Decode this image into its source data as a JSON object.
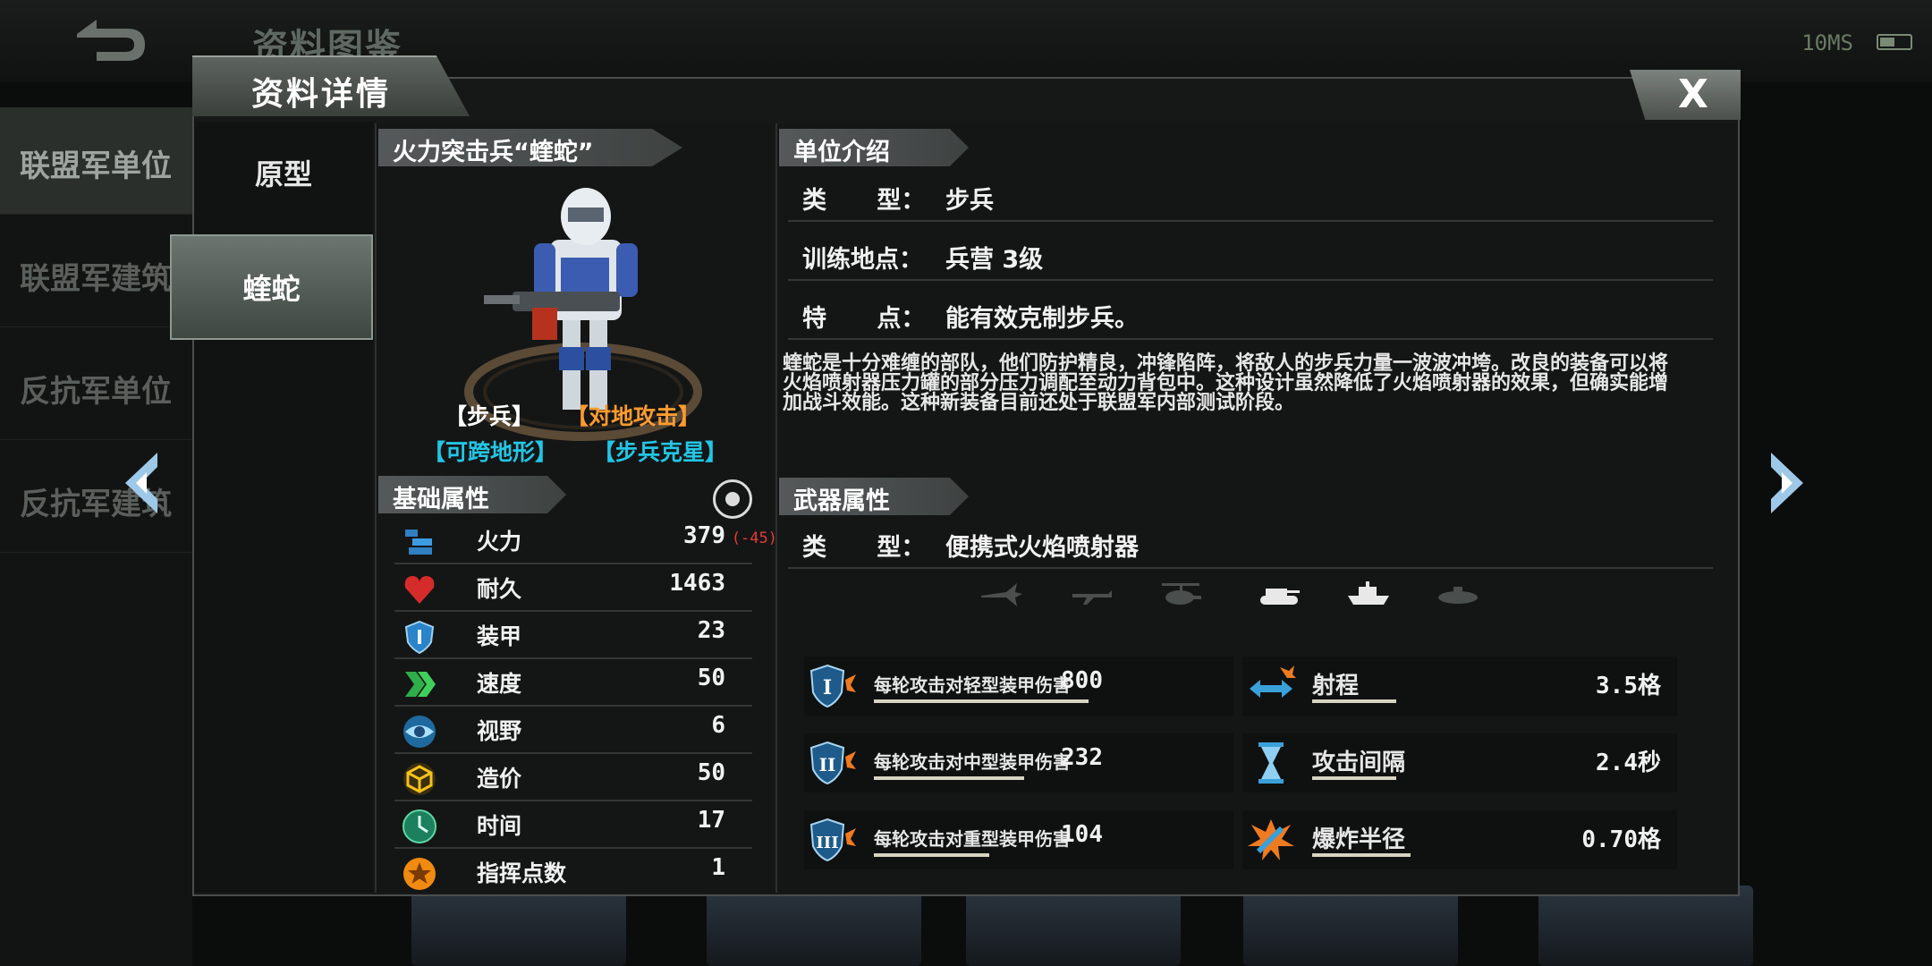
{
  "background": {
    "screen_title": "资料图鉴",
    "status_text": "10MS",
    "sidebar": [
      "联盟军单位",
      "联盟军建筑",
      "反抗军单位",
      "反抗军建筑"
    ]
  },
  "dialog": {
    "title": "资料详情",
    "close_label": "X"
  },
  "tabs": [
    {
      "label": "原型",
      "active": false
    },
    {
      "label": "蝰蛇",
      "active": true
    }
  ],
  "unit": {
    "name": "火力突击兵“蝰蛇”",
    "tags": [
      {
        "text": "【步兵】",
        "color": "#ffffff"
      },
      {
        "text": "【对地攻击】",
        "color": "#ff9b2e"
      },
      {
        "text": "【可跨地形】",
        "color": "#22c6e6"
      },
      {
        "text": "【步兵克星】",
        "color": "#22c6e6"
      }
    ]
  },
  "base_stats": {
    "header": "基础属性",
    "rows": [
      {
        "label": "火力",
        "value": "379",
        "mod": "(-45)",
        "icon": "firepower-icon"
      },
      {
        "label": "耐久",
        "value": "1463",
        "mod": "",
        "icon": "heart-icon"
      },
      {
        "label": "装甲",
        "value": "23",
        "mod": "",
        "icon": "shield-icon"
      },
      {
        "label": "速度",
        "value": "50",
        "mod": "",
        "icon": "speed-chevron-icon"
      },
      {
        "label": "视野",
        "value": "6",
        "mod": "",
        "icon": "eye-icon"
      },
      {
        "label": "造价",
        "value": "50",
        "mod": "",
        "icon": "cube-icon"
      },
      {
        "label": "时间",
        "value": "17",
        "mod": "",
        "icon": "clock-icon"
      },
      {
        "label": "指挥点数",
        "value": "1",
        "mod": "",
        "icon": "star-icon"
      }
    ]
  },
  "intro": {
    "header": "单位介绍",
    "rows": [
      {
        "key": "类      型：",
        "value": "步兵"
      },
      {
        "key": "训练地点：",
        "value": "兵营 3级"
      },
      {
        "key": "特      点：",
        "value": "能有效克制步兵。"
      }
    ],
    "description": "蝰蛇是十分难缠的部队，他们防护精良，冲锋陷阵，将敌人的步兵力量一波波冲垮。改良的装备可以将火焰喷射器压力罐的部分压力调配至动力背包中。这种设计虽然降低了火焰喷射器的效果，但确实能增加战斗效能。这种新装备目前还处于联盟军内部测试阶段。"
  },
  "weapon": {
    "header": "武器属性",
    "type_key": "类      型：",
    "type_value": "便携式火焰喷射器",
    "targets": [
      {
        "icon": "jet-icon",
        "active": false
      },
      {
        "icon": "plane-icon",
        "active": false
      },
      {
        "icon": "helicopter-icon",
        "active": false
      },
      {
        "icon": "tank-icon",
        "active": true
      },
      {
        "icon": "ship-icon",
        "active": true
      },
      {
        "icon": "submarine-icon",
        "active": false
      }
    ],
    "damage": [
      {
        "label": "每轮攻击对轻型装甲伤害",
        "value": "800",
        "roman": "I",
        "fill": 0.8
      },
      {
        "label": "每轮攻击对中型装甲伤害",
        "value": "232",
        "roman": "II",
        "fill": 0.56
      },
      {
        "label": "每轮攻击对重型装甲伤害",
        "value": "104",
        "roman": "III",
        "fill": 0.43
      }
    ],
    "props": [
      {
        "label": "射程",
        "value": "3.5格",
        "icon": "range-arrows-icon"
      },
      {
        "label": "攻击间隔",
        "value": "2.4秒",
        "icon": "hourglass-icon"
      },
      {
        "label": "爆炸半径",
        "value": "0.70格",
        "icon": "blast-radius-icon"
      }
    ]
  }
}
